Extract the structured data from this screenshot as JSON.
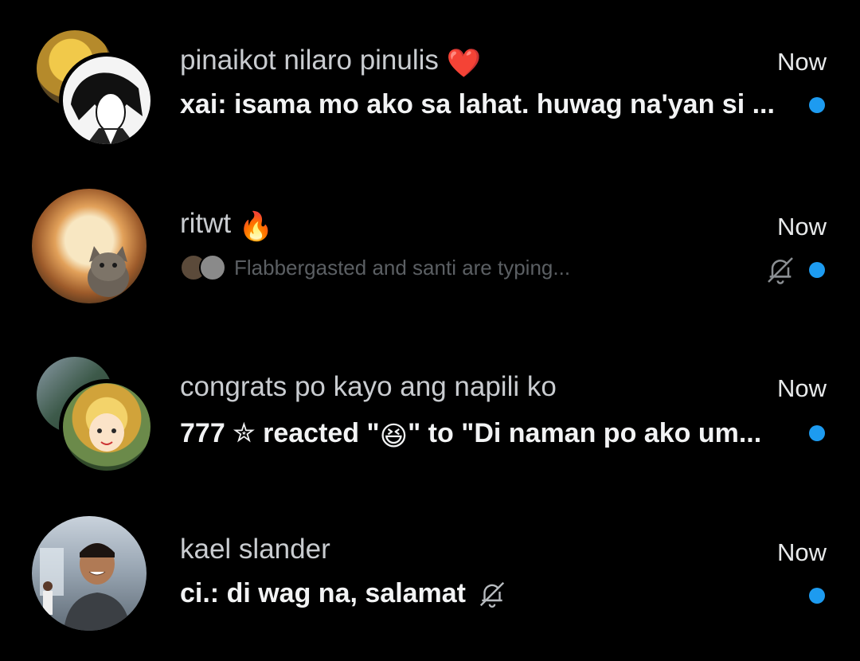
{
  "conversations": [
    {
      "title": "pinaikot nilaro pinulis",
      "title_emoji": "❤️",
      "time": "Now",
      "preview": "xai: isama mo ako sa lahat. huwag na'yan si ...",
      "unread": true,
      "muted": false,
      "avatar": "group-avatar-anime"
    },
    {
      "title": "ritwt",
      "title_emoji": "🔥",
      "time": "Now",
      "typing": "Flabbergasted and santi are typing...",
      "unread": true,
      "muted": true,
      "avatar": "cat-explosion-avatar"
    },
    {
      "title": "congrats po kayo ang napili ko",
      "time": "Now",
      "preview_before": "777 ✮ reacted \"",
      "preview_emoji": "😆",
      "preview_after": "\" to \"Di naman po ako um...",
      "unread": true,
      "muted": false,
      "avatar": "group-avatar-anime-blond"
    },
    {
      "title": "kael slander",
      "time": "Now",
      "preview": "ci.: di wag na, salamat",
      "unread": true,
      "muted": true,
      "avatar": "person-photo-avatar"
    }
  ],
  "colors": {
    "background": "#000000",
    "accent": "#1d9bf0",
    "muted_text": "#5b5f63"
  }
}
